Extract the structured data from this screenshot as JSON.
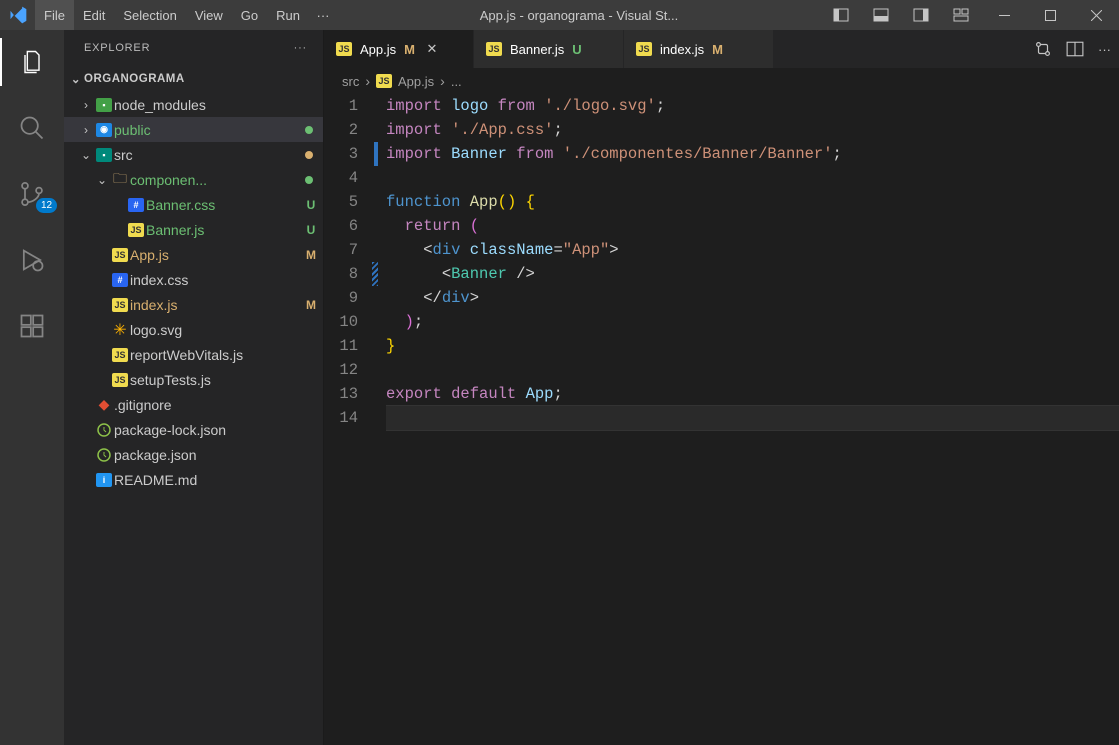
{
  "menubar": {
    "items": [
      "File",
      "Edit",
      "Selection",
      "View",
      "Go",
      "Run"
    ],
    "overflow": "···"
  },
  "window": {
    "title": "App.js - organograma - Visual St..."
  },
  "activitybar": {
    "badge_scm": "12"
  },
  "sidebar": {
    "title": "EXPLORER",
    "more": "···",
    "root": "ORGANOGRAMA"
  },
  "tree": {
    "items": [
      {
        "depth": 0,
        "kind": "folder",
        "chev": ">",
        "icon": "folder-green",
        "label": "node_modules",
        "status": "",
        "labelClass": ""
      },
      {
        "depth": 0,
        "kind": "folder",
        "chev": ">",
        "icon": "folder-blue",
        "label": "public",
        "status": "dot-unt",
        "labelClass": "unt",
        "selected": true
      },
      {
        "depth": 0,
        "kind": "folder",
        "chev": "v",
        "icon": "folder-teal",
        "label": "src",
        "status": "dot-mod",
        "labelClass": ""
      },
      {
        "depth": 1,
        "kind": "folder",
        "chev": "v",
        "icon": "folder-gray",
        "label": "componen...",
        "status": "dot-unt",
        "labelClass": "unt"
      },
      {
        "depth": 2,
        "kind": "file",
        "icon": "css",
        "label": "Banner.css",
        "status": "U",
        "labelClass": "unt"
      },
      {
        "depth": 2,
        "kind": "file",
        "icon": "js",
        "label": "Banner.js",
        "status": "U",
        "labelClass": "unt"
      },
      {
        "depth": 1,
        "kind": "file",
        "icon": "js",
        "label": "App.js",
        "status": "M",
        "labelClass": "mod"
      },
      {
        "depth": 1,
        "kind": "file",
        "icon": "css",
        "label": "index.css",
        "status": "",
        "labelClass": ""
      },
      {
        "depth": 1,
        "kind": "file",
        "icon": "js",
        "label": "index.js",
        "status": "M",
        "labelClass": "mod"
      },
      {
        "depth": 1,
        "kind": "file",
        "icon": "svg",
        "label": "logo.svg",
        "status": "",
        "labelClass": ""
      },
      {
        "depth": 1,
        "kind": "file",
        "icon": "js",
        "label": "reportWebVitals.js",
        "status": "",
        "labelClass": ""
      },
      {
        "depth": 1,
        "kind": "file",
        "icon": "js",
        "label": "setupTests.js",
        "status": "",
        "labelClass": ""
      },
      {
        "depth": 0,
        "kind": "file",
        "icon": "git",
        "label": ".gitignore",
        "status": "",
        "labelClass": ""
      },
      {
        "depth": 0,
        "kind": "file",
        "icon": "json",
        "label": "package-lock.json",
        "status": "",
        "labelClass": ""
      },
      {
        "depth": 0,
        "kind": "file",
        "icon": "json",
        "label": "package.json",
        "status": "",
        "labelClass": ""
      },
      {
        "depth": 0,
        "kind": "file",
        "icon": "readme",
        "label": "README.md",
        "status": "",
        "labelClass": ""
      }
    ]
  },
  "tabs": [
    {
      "icon": "js",
      "name": "App.js",
      "status": "M",
      "statusClass": "status-M",
      "active": true,
      "close": true
    },
    {
      "icon": "js",
      "name": "Banner.js",
      "status": "U",
      "statusClass": "status-U",
      "active": false,
      "close": false,
      "nameClass": "unt"
    },
    {
      "icon": "js",
      "name": "index.js",
      "status": "M",
      "statusClass": "status-M",
      "active": false,
      "close": false,
      "nameClass": "mod"
    }
  ],
  "breadcrumbs": {
    "parts": [
      {
        "text": "src",
        "icon": ""
      },
      {
        "text": "App.js",
        "icon": "js"
      },
      {
        "text": "...",
        "icon": ""
      }
    ]
  },
  "code": {
    "lines": [
      {
        "n": 1,
        "html": "<span class='tok-kw2'>import</span> <span class='tok-id'>logo</span> <span class='tok-kw2'>from</span> <span class='tok-str'>'./logo.svg'</span><span class='tok-pun'>;</span>"
      },
      {
        "n": 2,
        "html": "<span class='tok-kw2'>import</span> <span class='tok-str'>'./App.css'</span><span class='tok-pun'>;</span>"
      },
      {
        "n": 3,
        "marker": "blue",
        "html": "<span class='tok-kw2'>import</span> <span class='tok-id'>Banner</span> <span class='tok-kw2'>from</span> <span class='tok-str'>'./componentes/Banner/Banner'</span><span class='tok-pun'>;</span>"
      },
      {
        "n": 4,
        "html": ""
      },
      {
        "n": 5,
        "html": "<span class='tok-kw'>function</span> <span class='tok-fn'>App</span><span class='tok-br'>()</span> <span class='tok-br'>{</span>"
      },
      {
        "n": 6,
        "html": "  <span class='tok-kw2'>return</span> <span class='tok-br2'>(</span>"
      },
      {
        "n": 7,
        "html": "    <span class='tok-pun'>&lt;</span><span class='tok-tag'>div</span> <span class='tok-id'>className</span><span class='tok-pun'>=</span><span class='tok-str'>\"App\"</span><span class='tok-pun'>&gt;</span>"
      },
      {
        "n": 8,
        "marker": "stripe",
        "html": "      <span class='tok-pun'>&lt;</span><span class='tok-type'>Banner</span> <span class='tok-pun'>/&gt;</span>"
      },
      {
        "n": 9,
        "html": "    <span class='tok-pun'>&lt;/</span><span class='tok-tag'>div</span><span class='tok-pun'>&gt;</span>"
      },
      {
        "n": 10,
        "html": "  <span class='tok-br2'>)</span><span class='tok-pun'>;</span>"
      },
      {
        "n": 11,
        "html": "<span class='tok-br'>}</span>"
      },
      {
        "n": 12,
        "html": ""
      },
      {
        "n": 13,
        "html": "<span class='tok-kw2'>export</span> <span class='tok-kw2'>default</span> <span class='tok-id'>App</span><span class='tok-pun'>;</span>"
      },
      {
        "n": 14,
        "current": true,
        "html": ""
      }
    ]
  }
}
